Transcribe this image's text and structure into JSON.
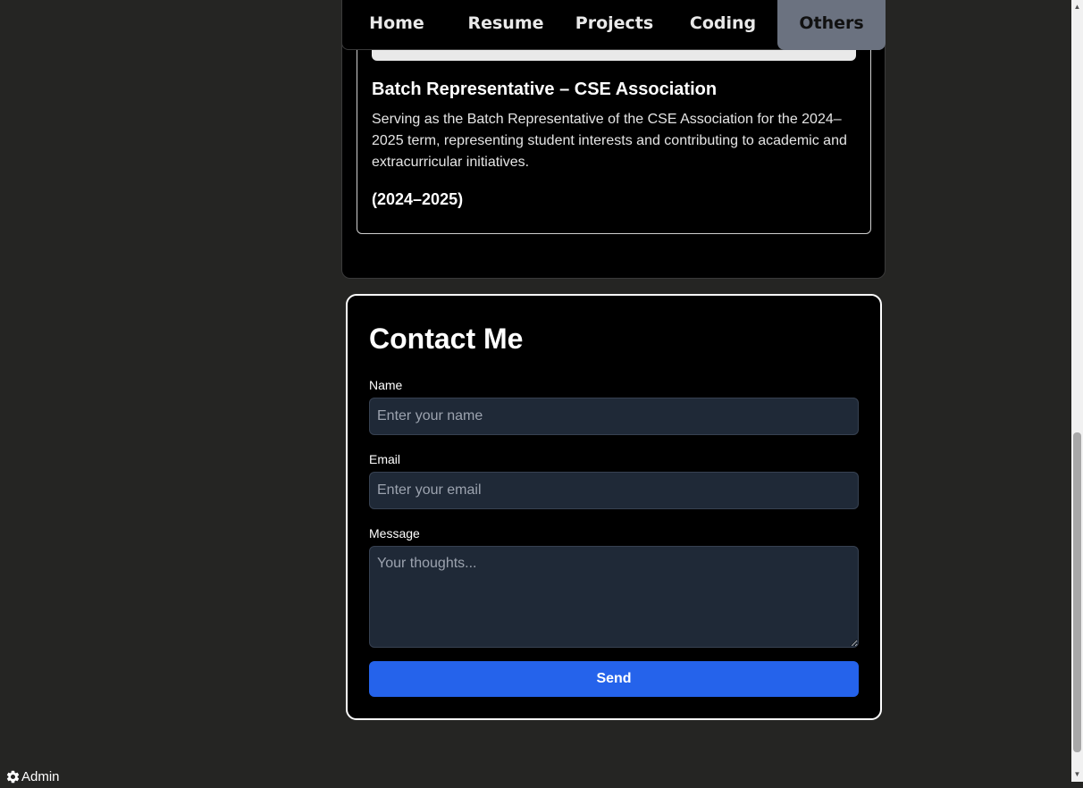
{
  "nav": {
    "items": [
      {
        "label": "Home"
      },
      {
        "label": "Resume"
      },
      {
        "label": "Projects"
      },
      {
        "label": "Coding"
      },
      {
        "label": "Others"
      }
    ],
    "active": "Others"
  },
  "experience": {
    "title": "Batch Representative – CSE Association",
    "description": "Serving as the Batch Representative of the CSE Association for the 2024–2025 term, representing student interests and contributing to academic and extracurricular initiatives.",
    "period": "(2024–2025)"
  },
  "contact": {
    "title": "Contact Me",
    "name_label": "Name",
    "name_placeholder": "Enter your name",
    "email_label": "Email",
    "email_placeholder": "Enter your email",
    "message_label": "Message",
    "message_placeholder": "Your thoughts...",
    "send_label": "Send"
  },
  "footer": {
    "admin_label": "Admin",
    "admin_icon": "gear-icon"
  },
  "colors": {
    "page_bg": "#252523",
    "panel_bg": "#000000",
    "active_tab": "#6b7280",
    "input_bg": "#1f2937",
    "send_button": "#2563eb"
  }
}
